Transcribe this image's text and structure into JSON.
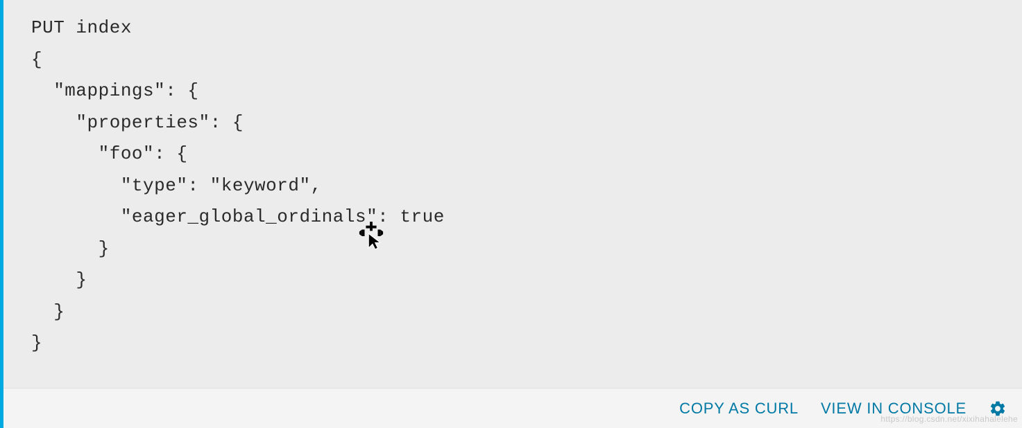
{
  "code": {
    "line1": "PUT index",
    "line2": "{",
    "line3": "  \"mappings\": {",
    "line4": "    \"properties\": {",
    "line5": "      \"foo\": {",
    "line6": "        \"type\": \"keyword\",",
    "line7": "        \"eager_global_ordinals\": true",
    "line8": "      }",
    "line9": "    }",
    "line10": "  }",
    "line11": "}"
  },
  "actions": {
    "copy_curl": "COPY AS CURL",
    "view_console": "VIEW IN CONSOLE"
  },
  "watermark": "https://blog.csdn.net/xixihahalelehe"
}
